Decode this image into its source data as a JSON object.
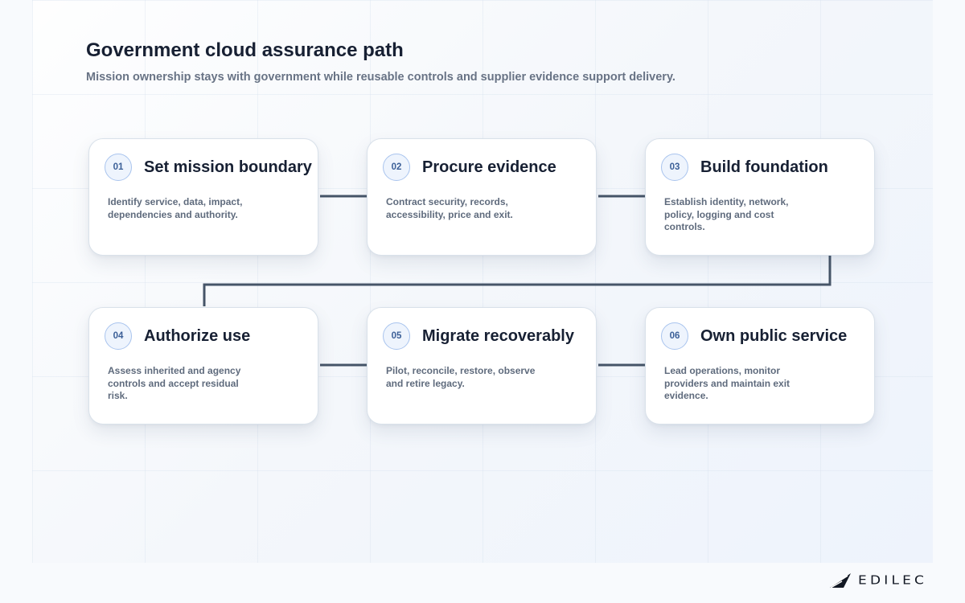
{
  "diagram": {
    "title": "Government cloud assurance path",
    "subtitle": "Mission ownership stays with government while reusable controls and supplier evidence support delivery.",
    "steps": [
      {
        "number": "01",
        "title": "Set mission boundary",
        "description": "Identify service, data, impact, dependencies and authority."
      },
      {
        "number": "02",
        "title": "Procure evidence",
        "description": "Contract security, records, accessibility, price and exit."
      },
      {
        "number": "03",
        "title": "Build foundation",
        "description": "Establish identity, network, policy, logging and cost controls."
      },
      {
        "number": "04",
        "title": "Authorize use",
        "description": "Assess inherited and agency controls and accept residual risk."
      },
      {
        "number": "05",
        "title": "Migrate recoverably",
        "description": "Pilot, reconcile, restore, observe and retire legacy."
      },
      {
        "number": "06",
        "title": "Own public service",
        "description": "Lead operations, monitor providers and maintain exit evidence."
      }
    ]
  },
  "branding": {
    "name": "EDILEC"
  },
  "colors": {
    "connector": "#465568",
    "badge_border": "#a9c4ee",
    "badge_background": "#eef4fd",
    "badge_text": "#3b5f97"
  }
}
